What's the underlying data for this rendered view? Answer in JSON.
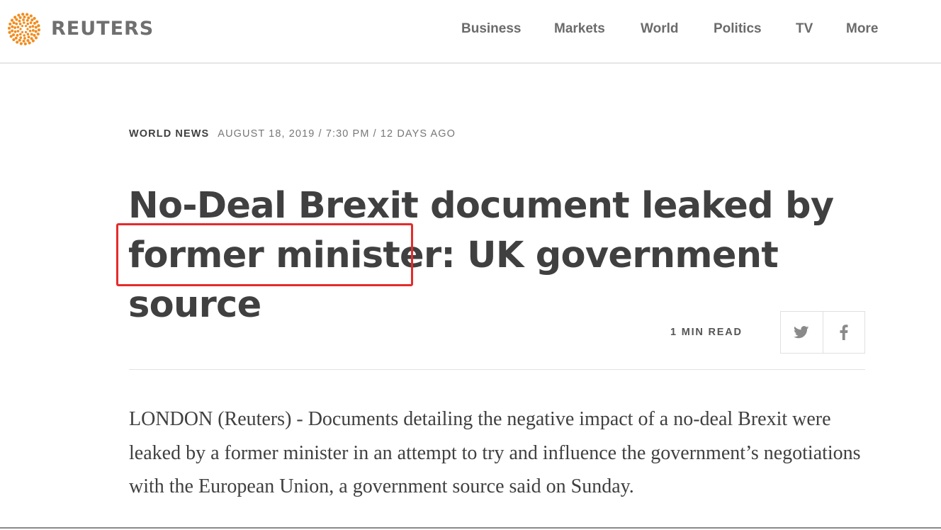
{
  "header": {
    "logo_text": "REUTERS",
    "nav": [
      "Business",
      "Markets",
      "World",
      "Politics",
      "TV",
      "More"
    ]
  },
  "article": {
    "section": "WORLD NEWS",
    "dateline": "AUGUST 18, 2019 / 7:30 PM / 12 DAYS AGO",
    "headline": "No-Deal Brexit document leaked by former minister: UK government source",
    "read_time": "1 MIN READ",
    "share": {
      "twitter_icon": "twitter-icon",
      "facebook_icon": "facebook-icon"
    },
    "body": "LONDON (Reuters) - Documents detailing the negative impact of a no-deal Brexit were leaked by a former minister in an attempt to try and influence the government’s negotiations with the European Union, a government source said on Sunday."
  },
  "colors": {
    "brand_orange": "#f28c1e",
    "highlight_red": "#e52b2b",
    "text": "#404040"
  }
}
